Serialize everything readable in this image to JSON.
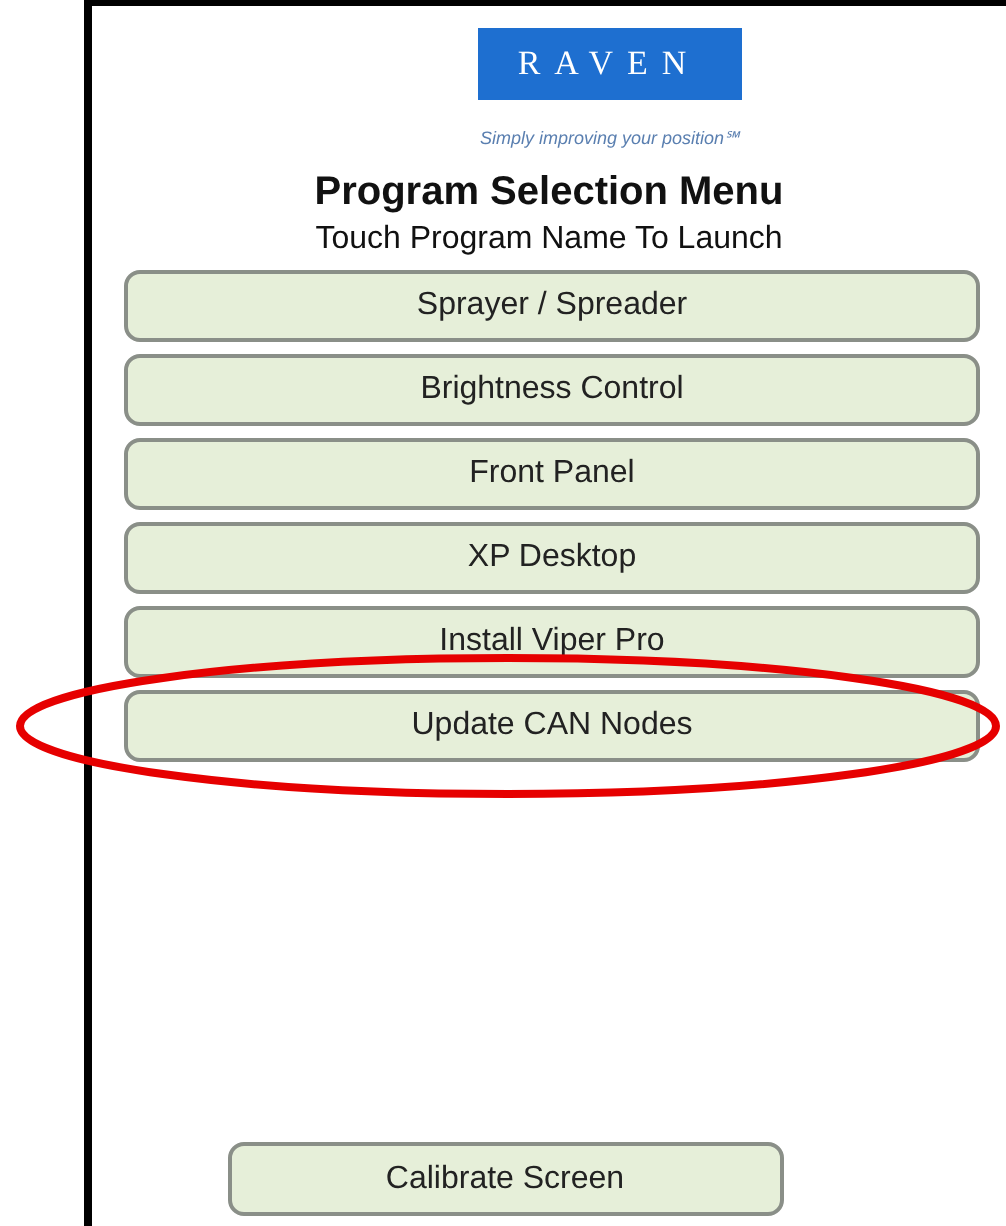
{
  "logo": {
    "text": "RAVEN",
    "tagline": "Simply improving your position℠"
  },
  "title": "Program Selection Menu",
  "subtitle": "Touch Program Name To Launch",
  "programs": [
    {
      "label": "Sprayer / Spreader",
      "circled": false
    },
    {
      "label": "Brightness Control",
      "circled": false
    },
    {
      "label": "Front Panel",
      "circled": false
    },
    {
      "label": "XP Desktop",
      "circled": false
    },
    {
      "label": "Install Viper Pro",
      "circled": false
    },
    {
      "label": "Update CAN Nodes",
      "circled": true
    }
  ],
  "calibrate_button": "Calibrate Screen"
}
